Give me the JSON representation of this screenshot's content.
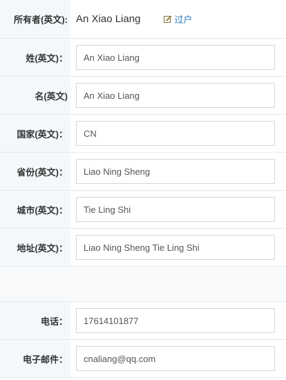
{
  "owner": {
    "label": "所有者(英文):",
    "value": "An Xiao Liang",
    "transfer_label": "过户",
    "transfer_icon": "edit-icon"
  },
  "fields": [
    {
      "key": "surname",
      "label": "姓(英文)：",
      "value": "An Xiao Liang"
    },
    {
      "key": "given-name",
      "label": "名(英文)",
      "value": "An Xiao Liang"
    },
    {
      "key": "country",
      "label": "国家(英文)：",
      "value": "CN"
    },
    {
      "key": "province",
      "label": "省份(英文)：",
      "value": "Liao Ning Sheng"
    },
    {
      "key": "city",
      "label": "城市(英文)：",
      "value": "Tie Ling Shi"
    },
    {
      "key": "address",
      "label": "地址(英文)：",
      "value": "Liao Ning Sheng Tie Ling Shi"
    }
  ],
  "contact": [
    {
      "key": "phone",
      "label": "电话：",
      "value": "17614101877"
    },
    {
      "key": "email",
      "label": "电子邮件：",
      "value": "cnaliang@qq.com"
    }
  ]
}
